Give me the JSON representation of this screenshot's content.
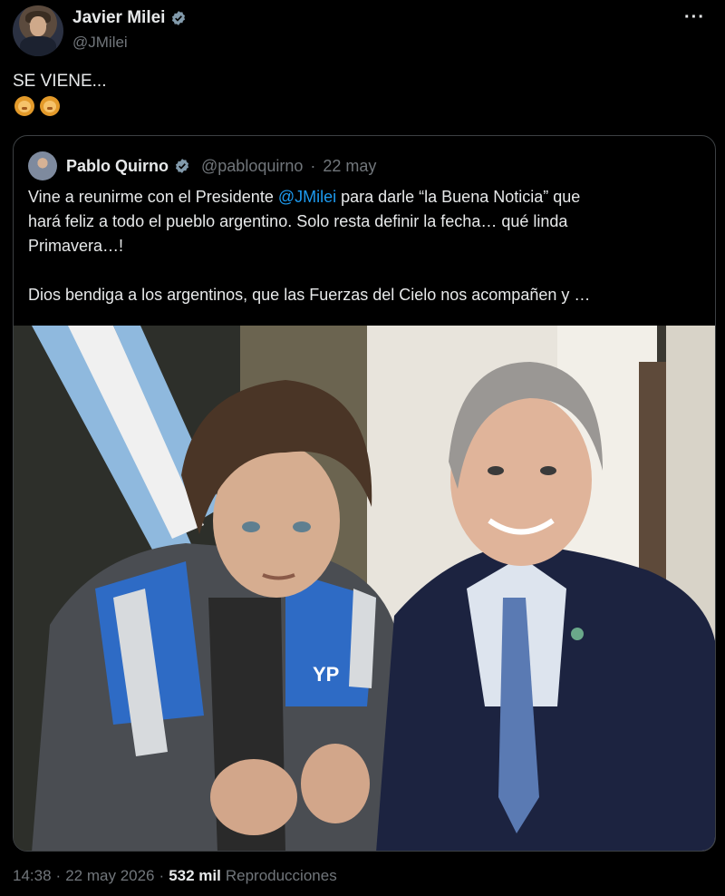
{
  "tweet": {
    "author": {
      "name": "Javier Milei",
      "handle": "@JMilei"
    },
    "text": "SE VIENE...",
    "more_label": "···",
    "timestamp": "14:38",
    "date": "22 may 2026",
    "separator": "·",
    "views_count": "532 mil",
    "views_label": "Reproducciones"
  },
  "quote": {
    "author": {
      "name": "Pablo Quirno",
      "handle": "@pabloquirno",
      "separator": "·",
      "date": "22 may"
    },
    "line1_a": "Vine a reunirme con el Presidente ",
    "mention": "@JMilei",
    "line1_b": " para darle “la Buena Noticia” que",
    "line2": "hará feliz a todo el pueblo argentino. Solo resta definir la fecha… qué linda",
    "line3": "Primavera…!",
    "line4": "Dios bendiga a los argentinos, que las Fuerzas del  Cielo nos acompañen y …",
    "photo_jacket_text": "YP"
  },
  "colors": {
    "accent": "#1d9bf0",
    "verified": "#829aab",
    "muted": "#71767b"
  },
  "icons": [
    "verified-badge-icon",
    "more-icon",
    "lion-emoji-icon"
  ]
}
